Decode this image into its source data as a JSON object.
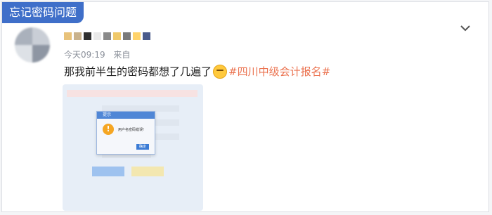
{
  "tag": {
    "label": "忘记密码问题"
  },
  "post": {
    "time": "今天09:19",
    "source_prefix": "来自",
    "text": "那我前半生的密码都想了几遍了",
    "hashtag": "#四川中级会计报名#"
  },
  "image": {
    "dialog_title": "提示",
    "dialog_message": "用户名密码错误!",
    "dialog_button": "确定"
  },
  "colors": {
    "tag_bg": "#3f6fc9",
    "hashtag": "#eb7350"
  }
}
